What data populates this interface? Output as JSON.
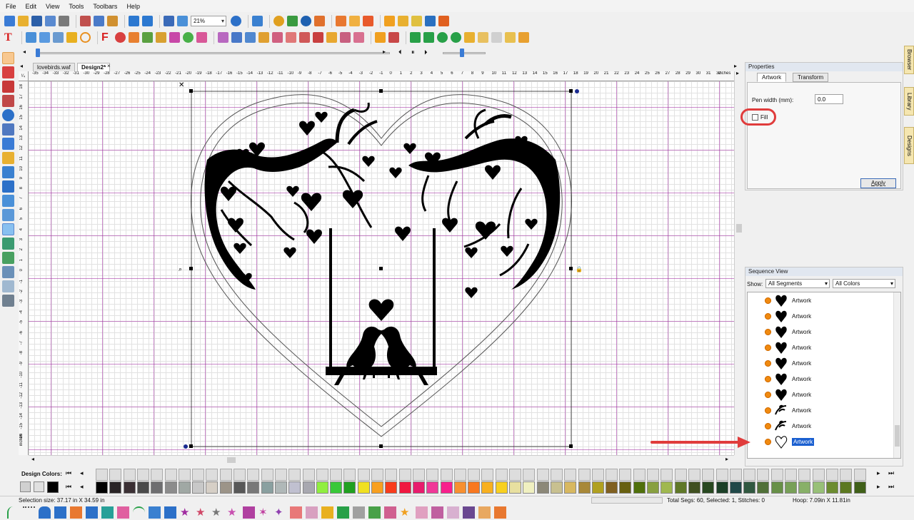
{
  "menu": [
    "File",
    "Edit",
    "View",
    "Tools",
    "Toolbars",
    "Help"
  ],
  "toolbar": {
    "zoom": "21%"
  },
  "tabs": [
    {
      "label": "lovebirds.waf",
      "active": false
    },
    {
      "label": "Design2*",
      "active": true
    }
  ],
  "ruler": {
    "h_ticks": [
      "-35",
      "-34",
      "-33",
      "-32",
      "-31",
      "-30",
      "-29",
      "-28",
      "-27",
      "-26",
      "-25",
      "-24",
      "-23",
      "-22",
      "-21",
      "-20",
      "-19",
      "-18",
      "-17",
      "-16",
      "-15",
      "-14",
      "-13",
      "-12",
      "-11",
      "-10",
      "-9",
      "-8",
      "-7",
      "-6",
      "-5",
      "-4",
      "-3",
      "-2",
      "-1",
      "0",
      "1",
      "2",
      "3",
      "4",
      "5",
      "6",
      "7",
      "8",
      "9",
      "10",
      "11",
      "12",
      "13",
      "14",
      "15",
      "16",
      "17",
      "18",
      "19",
      "20",
      "21",
      "22",
      "23",
      "24",
      "25",
      "26",
      "27",
      "28",
      "29",
      "30",
      "31",
      "32"
    ],
    "h_unit": "inches",
    "v_ticks": [
      "18",
      "17",
      "16",
      "15",
      "14",
      "13",
      "12",
      "11",
      "10",
      "9",
      "8",
      "7",
      "6",
      "5",
      "4",
      "3",
      "2",
      "1",
      "0",
      "-1",
      "-2",
      "-3",
      "-4",
      "-5",
      "-6",
      "-7",
      "-8",
      "-9",
      "-10",
      "-11",
      "-12",
      "-13",
      "-14",
      "-15",
      "-16",
      "-17"
    ],
    "v_unit": "inches"
  },
  "properties": {
    "title": "Properties",
    "tabs": [
      "Artwork",
      "Transform"
    ],
    "active_tab": "Artwork",
    "pen_width_label": "Pen width (mm):",
    "pen_width_value": "0.0",
    "fill_label": "Fill",
    "fill_checked": false,
    "apply_label": "Apply"
  },
  "side_tabs": [
    "Browser",
    "Library",
    "Designs"
  ],
  "sequence": {
    "title": "Sequence View",
    "show_label": "Show:",
    "segments_value": "All Segments",
    "colors_value": "All Colors",
    "items": [
      {
        "label": "Artwork",
        "thumb": "heart-solid",
        "selected": false
      },
      {
        "label": "Artwork",
        "thumb": "heart-solid",
        "selected": false
      },
      {
        "label": "Artwork",
        "thumb": "heart-solid",
        "selected": false
      },
      {
        "label": "Artwork",
        "thumb": "heart-solid",
        "selected": false
      },
      {
        "label": "Artwork",
        "thumb": "heart-solid",
        "selected": false
      },
      {
        "label": "Artwork",
        "thumb": "heart-solid",
        "selected": false
      },
      {
        "label": "Artwork",
        "thumb": "heart-solid",
        "selected": false
      },
      {
        "label": "Artwork",
        "thumb": "branch",
        "selected": false
      },
      {
        "label": "Artwork",
        "thumb": "branch",
        "selected": false
      },
      {
        "label": "Artwork",
        "thumb": "heart-outline",
        "selected": true
      }
    ]
  },
  "palette": {
    "label": "Design Colors:",
    "colors": [
      "#000000",
      "#2a2426",
      "#3b3034",
      "#4a4a4a",
      "#6e6e70",
      "#8c8c8c",
      "#a0a8a4",
      "#c8c8c8",
      "#d6cfc6",
      "#9c9488",
      "#585858",
      "#787878",
      "#8aa0a0",
      "#b0b8b8",
      "#c0c0d0",
      "#a8a8b0",
      "#90ee40",
      "#38c838",
      "#20a020",
      "#f0e020",
      "#f8a020",
      "#f83c1c",
      "#f01840",
      "#e81c6c",
      "#f03898",
      "#f8208c",
      "#f89030",
      "#f87820",
      "#f8b020",
      "#f8d020",
      "#e8e0a0",
      "#f0f0c0",
      "#8c8878",
      "#c8c090",
      "#d8b860",
      "#a88838",
      "#b0a020",
      "#806020",
      "#686010",
      "#50700c",
      "#88a040",
      "#a0b850",
      "#607828",
      "#405020",
      "#284820",
      "#1c4028",
      "#204848",
      "#305840",
      "#507038",
      "#689048",
      "#78a058",
      "#88b068",
      "#98c078",
      "#6c8c30",
      "#5c7820",
      "#406018"
    ]
  },
  "status": {
    "selection_size": "Selection size: 37.17 in X 34.59 in",
    "segs": "Total Segs: 60, Selected: 1, Stitches: 0",
    "hoop": "Hoop: 7.09in X 11.81in"
  },
  "colors": {
    "annotation_red": "#e03c3c",
    "selection_blue": "#1a5fd0"
  }
}
